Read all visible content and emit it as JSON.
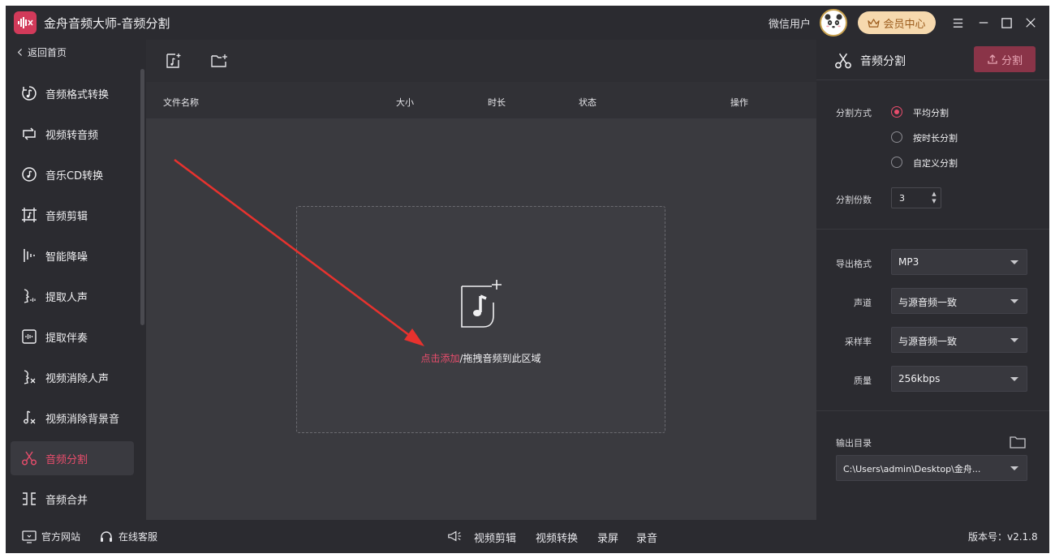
{
  "window": {
    "title": "金舟音频大师-音频分割"
  },
  "header": {
    "user_label": "微信用户",
    "vip_label": "会员中心",
    "icons": [
      "app-logo-icon",
      "avatar",
      "crown-icon",
      "menu-icon",
      "minimize-icon",
      "maximize-icon",
      "close-icon"
    ]
  },
  "sidebar": {
    "back_label": "返回首页",
    "items": [
      {
        "label": "音频格式转换",
        "icon": "audio-convert-icon"
      },
      {
        "label": "视频转音频",
        "icon": "video-to-audio-icon"
      },
      {
        "label": "音乐CD转换",
        "icon": "music-cd-icon"
      },
      {
        "label": "音频剪辑",
        "icon": "audio-edit-icon"
      },
      {
        "label": "智能降噪",
        "icon": "noise-reduce-icon"
      },
      {
        "label": "提取人声",
        "icon": "extract-vocal-icon"
      },
      {
        "label": "提取伴奏",
        "icon": "extract-accompaniment-icon"
      },
      {
        "label": "视频消除人声",
        "icon": "video-remove-vocal-icon"
      },
      {
        "label": "视频消除背景音",
        "icon": "video-remove-bgm-icon"
      },
      {
        "label": "音频分割",
        "icon": "scissors-icon",
        "active": true
      },
      {
        "label": "音频合并",
        "icon": "audio-merge-icon"
      }
    ]
  },
  "table": {
    "columns": [
      "文件名称",
      "大小",
      "时长",
      "状态",
      "操作"
    ]
  },
  "dropzone": {
    "add_label": "点击添加",
    "drag_label": "/拖拽音频到此区域"
  },
  "panel": {
    "title": "音频分割",
    "split_button": "分割",
    "split_mode_label": "分割方式",
    "split_modes": [
      {
        "label": "平均分割",
        "selected": true
      },
      {
        "label": "按时长分割",
        "selected": false
      },
      {
        "label": "自定义分割",
        "selected": false
      }
    ],
    "parts_label": "分割份数",
    "parts_value": "3",
    "format_label": "导出格式",
    "format_value": "MP3",
    "channel_label": "声道",
    "channel_value": "与源音频一致",
    "sample_label": "采样率",
    "sample_value": "与源音频一致",
    "quality_label": "质量",
    "quality_value": "256kbps",
    "output_label": "输出目录",
    "output_value": "C:\\Users\\admin\\Desktop\\金舟..."
  },
  "bottom": {
    "website": "官方网站",
    "service": "在线客服",
    "links": [
      "视频剪辑",
      "视频转换",
      "录屏",
      "录音"
    ],
    "version": "版本号：v2.1.8"
  },
  "colors": {
    "accent": "#e84d6c",
    "bg": "#2e2e33",
    "panel": "#2b2b30",
    "vip": "#f6d9ae"
  }
}
